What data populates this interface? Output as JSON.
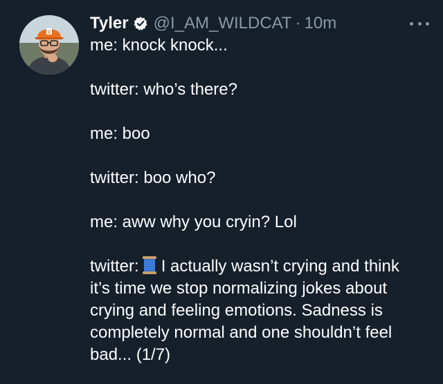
{
  "tweet": {
    "author": {
      "display_name": "Tyler",
      "handle": "@I_AM_WILDCAT",
      "verified": true,
      "avatar_icon": "avatar-man-orange-cap"
    },
    "separator": "·",
    "timestamp": "10m",
    "more_icon": "ellipsis-icon",
    "paragraphs": {
      "p1": "me: knock knock...",
      "p2": "twitter: who’s there?",
      "p3": "me: boo",
      "p4": "twitter: boo who?",
      "p5": "me: aww why you cryin? Lol",
      "p6_prefix": "twitter:",
      "p6_emoji": "spool-of-thread-emoji",
      "p6_rest": "I actually wasn’t crying and think it’s time we stop normalizing jokes about crying and feeling emotions. Sadness is completely normal and one shouldn’t feel bad... (1/7)"
    }
  },
  "colors": {
    "background": "#15202b",
    "primary_text": "#ffffff",
    "secondary_text": "#8b98a5",
    "verified_badge": "#ffffff"
  }
}
